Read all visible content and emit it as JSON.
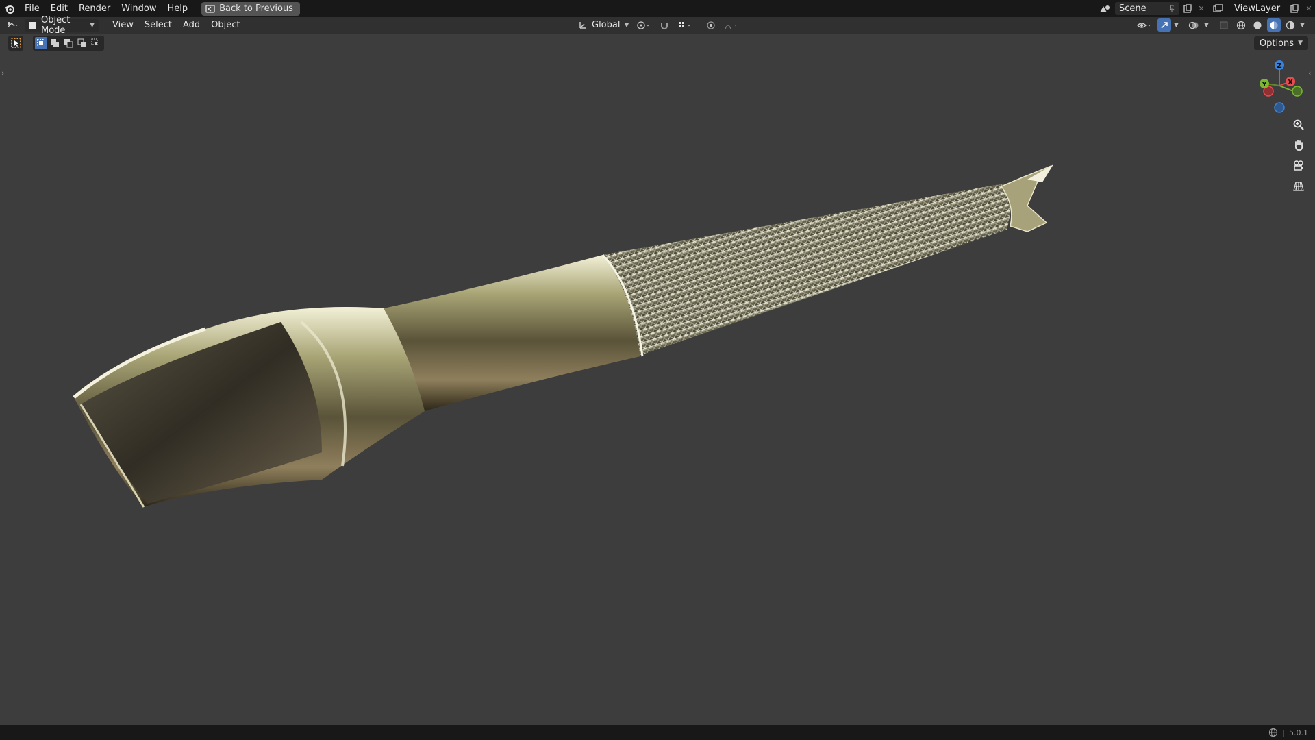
{
  "topbar": {
    "menus": [
      "File",
      "Edit",
      "Render",
      "Window",
      "Help"
    ],
    "back_button": "Back to Previous",
    "scene": "Scene",
    "view_layer": "ViewLayer"
  },
  "header": {
    "mode": "Object Mode",
    "menus": [
      "View",
      "Select",
      "Add",
      "Object"
    ],
    "orientation": "Global"
  },
  "viewport": {
    "options_label": "Options",
    "gizmo": {
      "x": "X",
      "y": "Y",
      "z": "Z"
    }
  },
  "statusbar": {
    "version": "5.0.1"
  },
  "colors": {
    "gizmo_x": "#e94a4e",
    "gizmo_y": "#7ab92e",
    "gizmo_z": "#3c82d6",
    "active_blue": "#4772b3"
  }
}
